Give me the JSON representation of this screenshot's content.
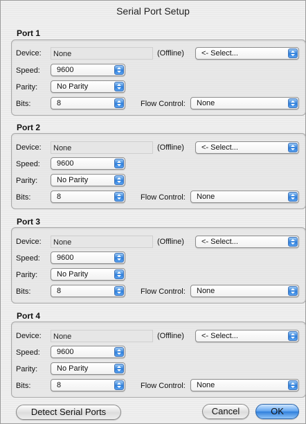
{
  "window": {
    "title": "Serial Port Setup"
  },
  "labels": {
    "device": "Device:",
    "speed": "Speed:",
    "parity": "Parity:",
    "bits": "Bits:",
    "flow_control": "Flow Control:"
  },
  "ports": [
    {
      "title": "Port 1",
      "device": "None",
      "status": "(Offline)",
      "device_select": "<- Select...",
      "speed": "9600",
      "parity": "No Parity",
      "bits": "8",
      "flow_control": "None"
    },
    {
      "title": "Port 2",
      "device": "None",
      "status": "(Offline)",
      "device_select": "<- Select...",
      "speed": "9600",
      "parity": "No Parity",
      "bits": "8",
      "flow_control": "None"
    },
    {
      "title": "Port 3",
      "device": "None",
      "status": "(Offline)",
      "device_select": "<- Select...",
      "speed": "9600",
      "parity": "No Parity",
      "bits": "8",
      "flow_control": "None"
    },
    {
      "title": "Port 4",
      "device": "None",
      "status": "(Offline)",
      "device_select": "<- Select...",
      "speed": "9600",
      "parity": "No Parity",
      "bits": "8",
      "flow_control": "None"
    }
  ],
  "buttons": {
    "detect": "Detect Serial Ports",
    "cancel": "Cancel",
    "ok": "OK"
  },
  "colors": {
    "accent": "#2f7fdb",
    "window_bg": "#ececec"
  }
}
